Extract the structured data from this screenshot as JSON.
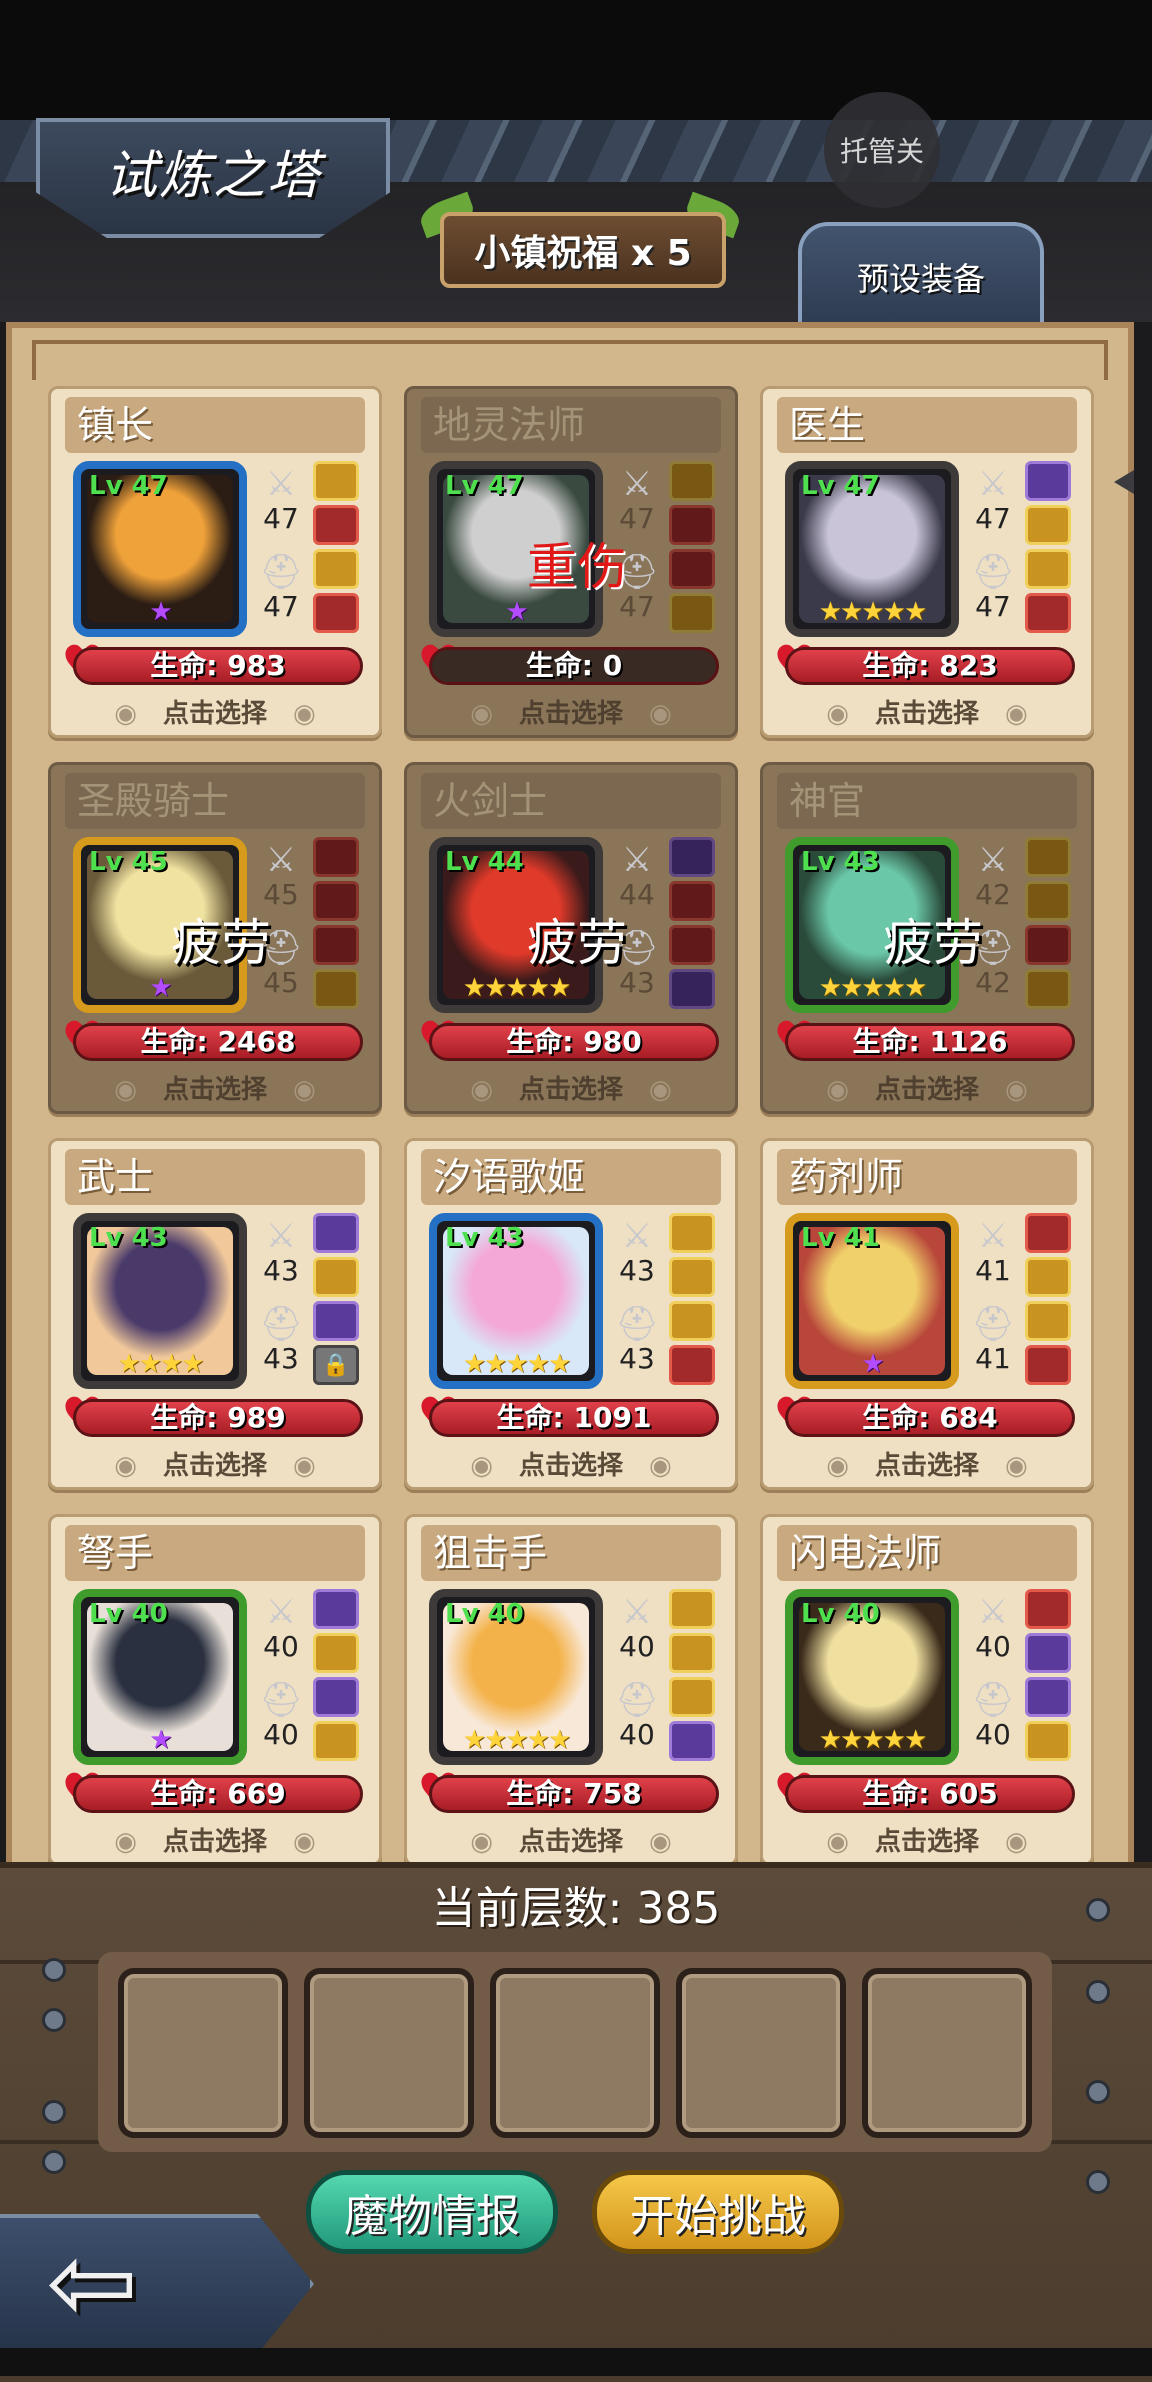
{
  "header": {
    "title": "试炼之塔",
    "auto_button": "托管关",
    "blessing": "小镇祝福 x 5",
    "preset_tab": "预设装备"
  },
  "heroes": [
    {
      "name": "镇长",
      "level": "Lv 47",
      "atk": "47",
      "def": "47",
      "hp": "生命: 983",
      "select": "点击选择",
      "stars": "★",
      "star_color": "purple",
      "frame": "blue",
      "status": "",
      "dim": false,
      "art": [
        "#f0a23a",
        "#2b1d14"
      ],
      "equip": [
        "gold",
        "red",
        "gold",
        "red"
      ]
    },
    {
      "name": "地灵法师",
      "level": "Lv 47",
      "atk": "47",
      "def": "47",
      "hp": "生命: 0",
      "select": "点击选择",
      "stars": "★",
      "star_color": "purple",
      "frame": "dark",
      "status": "重伤",
      "dim": true,
      "art": [
        "#cfcfcf",
        "#3a4a40"
      ],
      "equip": [
        "gold",
        "red",
        "red",
        "gold"
      ]
    },
    {
      "name": "医生",
      "level": "Lv 47",
      "atk": "47",
      "def": "47",
      "hp": "生命: 823",
      "select": "点击选择",
      "stars": "★★★★★",
      "star_color": "gold",
      "frame": "dark",
      "status": "",
      "dim": false,
      "art": [
        "#c9c4d8",
        "#3a3a4a"
      ],
      "equip": [
        "purple",
        "gold",
        "gold",
        "red"
      ]
    },
    {
      "name": "圣殿骑士",
      "level": "Lv 45",
      "atk": "45",
      "def": "45",
      "hp": "生命: 2468",
      "select": "点击选择",
      "stars": "★",
      "star_color": "purple",
      "frame": "gold",
      "status": "疲劳",
      "dim": true,
      "art": [
        "#f0e2a0",
        "#6a5a3a"
      ],
      "equip": [
        "red",
        "red",
        "red",
        "gold"
      ]
    },
    {
      "name": "火剑士",
      "level": "Lv 44",
      "atk": "44",
      "def": "43",
      "hp": "生命: 980",
      "select": "点击选择",
      "stars": "★★★★★",
      "star_color": "gold",
      "frame": "dark",
      "status": "疲劳",
      "dim": true,
      "art": [
        "#e03a2a",
        "#3a1a1a"
      ],
      "equip": [
        "purple",
        "red",
        "red",
        "purple"
      ]
    },
    {
      "name": "神官",
      "level": "Lv 43",
      "atk": "42",
      "def": "42",
      "hp": "生命: 1126",
      "select": "点击选择",
      "stars": "★★★★★",
      "star_color": "gold",
      "frame": "green",
      "status": "疲劳",
      "dim": true,
      "art": [
        "#6ac7a8",
        "#2a4a3a"
      ],
      "equip": [
        "gold",
        "gold",
        "red",
        "gold"
      ]
    },
    {
      "name": "武士",
      "level": "Lv 43",
      "atk": "43",
      "def": "43",
      "hp": "生命: 989",
      "select": "点击选择",
      "stars": "★★★★",
      "star_color": "gold",
      "frame": "dark",
      "status": "",
      "dim": false,
      "art": [
        "#4a3a6a",
        "#f0c89a"
      ],
      "equip": [
        "purple",
        "gold",
        "purple",
        "lock"
      ]
    },
    {
      "name": "汐语歌姬",
      "level": "Lv 43",
      "atk": "43",
      "def": "43",
      "hp": "生命: 1091",
      "select": "点击选择",
      "stars": "★★★★★",
      "star_color": "gold",
      "frame": "blue",
      "status": "",
      "dim": false,
      "art": [
        "#f4a8d8",
        "#d8e8f8"
      ],
      "equip": [
        "gold",
        "gold",
        "gold",
        "red"
      ]
    },
    {
      "name": "药剂师",
      "level": "Lv 41",
      "atk": "41",
      "def": "41",
      "hp": "生命: 684",
      "select": "点击选择",
      "stars": "★",
      "star_color": "purple",
      "frame": "gold",
      "status": "",
      "dim": false,
      "art": [
        "#f0d06a",
        "#b8463a"
      ],
      "equip": [
        "red",
        "gold",
        "gold",
        "red"
      ]
    },
    {
      "name": "弩手",
      "level": "Lv 40",
      "atk": "40",
      "def": "40",
      "hp": "生命: 669",
      "select": "点击选择",
      "stars": "★",
      "star_color": "purple",
      "frame": "green",
      "status": "",
      "dim": false,
      "art": [
        "#2a3040",
        "#e8e0d8"
      ],
      "equip": [
        "purple",
        "gold",
        "purple",
        "gold"
      ]
    },
    {
      "name": "狙击手",
      "level": "Lv 40",
      "atk": "40",
      "def": "40",
      "hp": "生命: 758",
      "select": "点击选择",
      "stars": "★★★★★",
      "star_color": "gold",
      "frame": "dark",
      "status": "",
      "dim": false,
      "art": [
        "#f4b24a",
        "#f8e8d8"
      ],
      "equip": [
        "gold",
        "gold",
        "gold",
        "purple"
      ]
    },
    {
      "name": "闪电法师",
      "level": "Lv 40",
      "atk": "40",
      "def": "40",
      "hp": "生命: 605",
      "select": "点击选择",
      "stars": "★★★★★",
      "star_color": "gold",
      "frame": "green",
      "status": "",
      "dim": false,
      "art": [
        "#f0e0a0",
        "#3a2a1a"
      ],
      "equip": [
        "red",
        "purple",
        "purple",
        "gold"
      ]
    }
  ],
  "footer": {
    "floor": "当前层数: 385",
    "monster_info": "魔物情报",
    "start_challenge": "开始挑战"
  },
  "colors": {
    "board": "#d2b78c",
    "hp_red": "#c0262e",
    "accent_green": "#2fb48c",
    "accent_yellow": "#e6ae2a"
  }
}
